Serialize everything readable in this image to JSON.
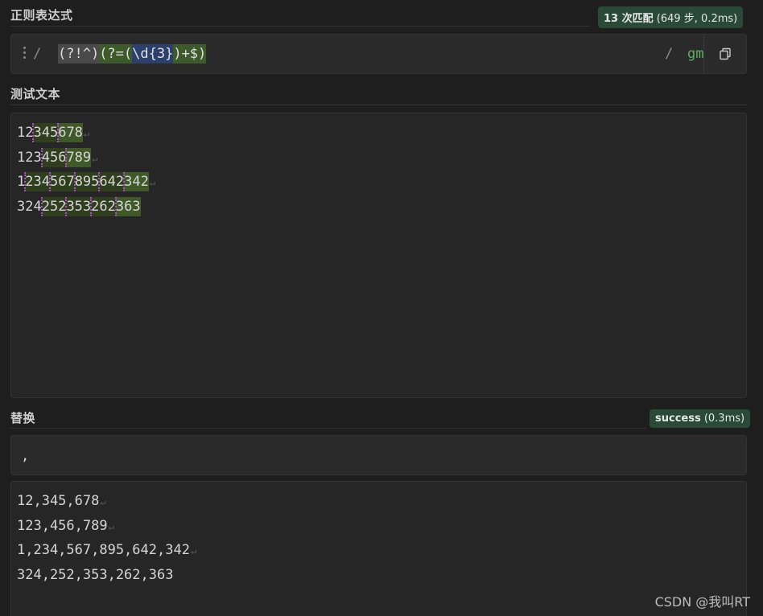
{
  "regex_section": {
    "label": "正则表达式",
    "badge_strong": "13 次匹配",
    "badge_rest": " (649 步, 0.2ms)",
    "delimiter_open": "/",
    "delimiter_close": "/",
    "tokens": [
      "(?!^)",
      "(?=(",
      "\\d{3}",
      ")+$)"
    ],
    "flags": "gm"
  },
  "test_section": {
    "label": "测试文本",
    "lines": [
      {
        "segments": [
          {
            "t": "12",
            "c": ""
          },
          {
            "t": "345",
            "c": "m-alt"
          },
          {
            "t": "678",
            "c": "m-last"
          }
        ]
      },
      {
        "segments": [
          {
            "t": "123",
            "c": ""
          },
          {
            "t": "456",
            "c": "m-alt"
          },
          {
            "t": "789",
            "c": "m-last"
          }
        ]
      },
      {
        "segments": [
          {
            "t": "1",
            "c": ""
          },
          {
            "t": "234",
            "c": "m-alt"
          },
          {
            "t": "567",
            "c": "m-alt"
          },
          {
            "t": "895",
            "c": "m-alt"
          },
          {
            "t": "642",
            "c": "m-alt"
          },
          {
            "t": "342",
            "c": "m-last"
          }
        ]
      },
      {
        "segments": [
          {
            "t": "324",
            "c": ""
          },
          {
            "t": "252",
            "c": "m-alt"
          },
          {
            "t": "353",
            "c": "m-alt"
          },
          {
            "t": "262",
            "c": "m-alt"
          },
          {
            "t": "363",
            "c": "m-last"
          }
        ]
      }
    ],
    "eol_marks": [
      true,
      true,
      true,
      false
    ],
    "eol_glyph": "↵"
  },
  "replace_section": {
    "label": "替换",
    "badge_strong": "success",
    "badge_rest": " (0.3ms)",
    "value": ","
  },
  "result_section": {
    "lines": [
      "12,345,678",
      "123,456,789",
      "1,234,567,895,642,342",
      "324,252,353,262,363"
    ],
    "eol_marks": [
      true,
      true,
      true,
      false
    ]
  },
  "watermark": "CSDN @我叫RT",
  "colors": {
    "background": "#1e1e1e",
    "panel": "#2a2a2a",
    "badge": "#2a4a38",
    "match_highlight": "#3f5a28",
    "match_position": "#b04ad0",
    "flags": "#5fb05f"
  },
  "icons": {
    "copy": "copy-icon",
    "drag": "drag-handle-icon"
  }
}
